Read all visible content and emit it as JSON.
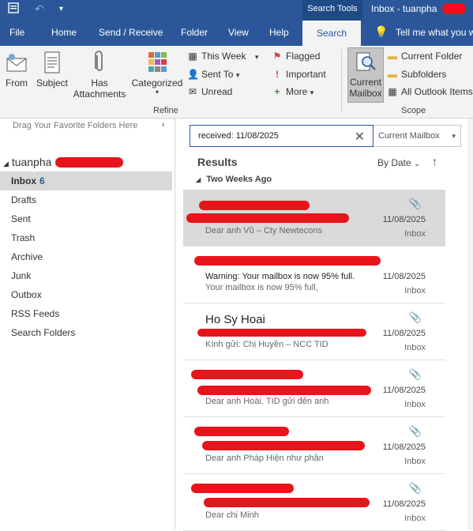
{
  "titlebar": {
    "context_tab": "Search Tools",
    "window_title": "Inbox - tuanpha"
  },
  "tabs": [
    "File",
    "Home",
    "Send / Receive",
    "Folder",
    "View",
    "Help",
    "Search",
    "Tell me what you w"
  ],
  "ribbon": {
    "from_label": "From",
    "subject_label": "Subject",
    "has_attachments_label": "Has Attachments",
    "categorized_label": "Categorized",
    "this_week_label": "This Week",
    "sent_to_label": "Sent To",
    "unread_label": "Unread",
    "flagged_label": "Flagged",
    "important_label": "Important",
    "more_label": "More",
    "refine_group": "Refine",
    "current_mailbox_label": "Current Mailbox",
    "current_folder_label": "Current Folder",
    "subfolders_label": "Subfolders",
    "all_outlook_items_label": "All Outlook Items",
    "scope_group": "Scope"
  },
  "folderpane": {
    "fav_hint": "Drag Your Favorite Folders Here",
    "account": "tuanpha",
    "folders": [
      {
        "name": "Inbox",
        "count": "6"
      },
      {
        "name": "Drafts"
      },
      {
        "name": "Sent"
      },
      {
        "name": "Trash"
      },
      {
        "name": "Archive"
      },
      {
        "name": "Junk"
      },
      {
        "name": "Outbox"
      },
      {
        "name": "RSS Feeds"
      },
      {
        "name": "Search Folders"
      }
    ]
  },
  "search": {
    "query": "received: 11/08/2025",
    "scope": "Current Mailbox"
  },
  "results": {
    "title": "Results",
    "sort_label": "By Date",
    "group_header": "Two Weeks Ago",
    "messages": [
      {
        "sender": "",
        "subject": "",
        "preview": "Dear anh Vũ – Cty Newtecons",
        "date": "11/08/2025",
        "folder": "Inbox"
      },
      {
        "sender": "",
        "subject": "Warning: Your mailbox is now 95% full.",
        "preview": "Your mailbox is now 95% full,",
        "date": "11/08/2025",
        "folder": "Inbox"
      },
      {
        "sender": "Ho Sy Hoai",
        "subject": "",
        "preview": "Kính gửi: Chị Huyền – NCC TID",
        "date": "11/08/2025",
        "folder": "Inbox"
      },
      {
        "sender": "",
        "subject": "",
        "preview": "Dear anh Hoài.  TID gửi đến anh",
        "date": "11/08/2025",
        "folder": "Inbox"
      },
      {
        "sender": "",
        "subject": "",
        "preview": "Dear anh Pháp  Hiện như phần",
        "date": "11/08/2025",
        "folder": "Inbox"
      },
      {
        "sender": "",
        "subject": "",
        "preview": "Dear chị Minh",
        "date": "11/08/2025",
        "folder": "Inbox"
      }
    ]
  }
}
